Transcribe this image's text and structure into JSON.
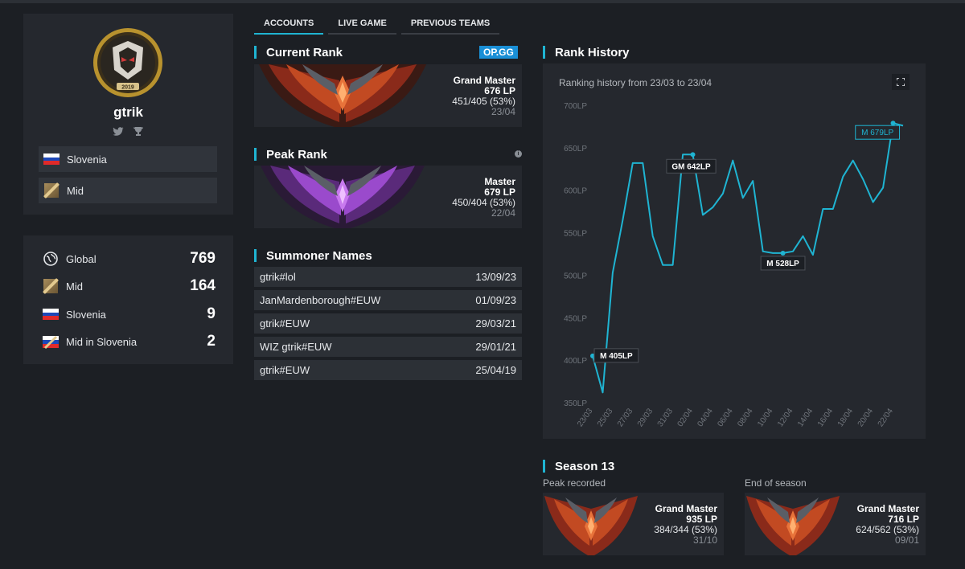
{
  "player": {
    "name": "gtrik",
    "logo_text": "2019"
  },
  "profile": {
    "country": "Slovenia",
    "role": "Mid"
  },
  "rankings": [
    {
      "label": "Global",
      "value": "769",
      "icon": "globe-icon"
    },
    {
      "label": "Mid",
      "value": "164",
      "icon": "mid-lane-icon"
    },
    {
      "label": "Slovenia",
      "value": "9",
      "icon": "slovenia-flag-icon"
    },
    {
      "label": "Mid in Slovenia",
      "value": "2",
      "icon": "mid-slovenia-icon"
    }
  ],
  "tabs": [
    {
      "label": "ACCOUNTS",
      "active": true
    },
    {
      "label": "LIVE GAME",
      "active": false
    },
    {
      "label": "PREVIOUS TEAMS",
      "active": false
    }
  ],
  "current_rank": {
    "title": "Current Rank",
    "source": "OP.GG",
    "tier": "Grand Master",
    "lp": "676 LP",
    "record": "451/405 (53%)",
    "date": "23/04"
  },
  "peak_rank": {
    "title": "Peak Rank",
    "tier": "Master",
    "lp": "679 LP",
    "record": "450/404 (53%)",
    "date": "22/04"
  },
  "summoner_names": {
    "title": "Summoner Names",
    "rows": [
      {
        "name": "gtrik#lol",
        "date": "13/09/23"
      },
      {
        "name": "JanMardenborough#EUW",
        "date": "01/09/23"
      },
      {
        "name": "gtrik#EUW",
        "date": "29/03/21"
      },
      {
        "name": "WIZ gtrik#EUW",
        "date": "29/01/21"
      },
      {
        "name": "gtrik#EUW",
        "date": "25/04/19"
      }
    ]
  },
  "rank_history": {
    "title": "Rank History",
    "subtitle": "Ranking history from 23/03 to 23/04"
  },
  "chart_data": {
    "type": "line",
    "x": [
      "23/03",
      "24/03",
      "25/03",
      "26/03",
      "27/03",
      "28/03",
      "29/03",
      "30/03",
      "31/03",
      "01/04",
      "02/04",
      "03/04",
      "04/04",
      "05/04",
      "06/04",
      "07/04",
      "08/04",
      "09/04",
      "10/04",
      "11/04",
      "12/04",
      "13/04",
      "14/04",
      "15/04",
      "16/04",
      "17/04",
      "18/04",
      "19/04",
      "20/04",
      "21/04",
      "22/04",
      "23/04"
    ],
    "xticks": [
      "23/03",
      "25/03",
      "27/03",
      "29/03",
      "31/03",
      "02/04",
      "04/04",
      "06/04",
      "08/04",
      "10/04",
      "12/04",
      "14/04",
      "16/04",
      "18/04",
      "20/04",
      "22/04"
    ],
    "series": [
      {
        "values": [
          405,
          362,
          503,
          565,
          632,
          632,
          546,
          512,
          512,
          642,
          642,
          571,
          580,
          596,
          635,
          591,
          611,
          528,
          526,
          526,
          528,
          546,
          524,
          578,
          578,
          616,
          635,
          613,
          586,
          603,
          679,
          676
        ],
        "color": "#1fb4d2"
      }
    ],
    "yticks": [
      350,
      400,
      450,
      500,
      550,
      600,
      650,
      700
    ],
    "ytick_suffix": "LP",
    "ylim": [
      350,
      700
    ],
    "grid": false,
    "annotations": [
      {
        "index": 0,
        "label": "M 405LP",
        "style": "dark"
      },
      {
        "index": 10,
        "label": "GM 642LP",
        "style": "dark"
      },
      {
        "index": 19,
        "label": "M 528LP",
        "style": "dark"
      },
      {
        "index": 30,
        "label": "M 679LP",
        "style": "accent"
      }
    ]
  },
  "season": {
    "title": "Season 13",
    "peak_label": "Peak recorded",
    "end_label": "End of season",
    "peak": {
      "tier": "Grand Master",
      "lp": "935 LP",
      "record": "384/344 (53%)",
      "date": "31/10"
    },
    "end": {
      "tier": "Grand Master",
      "lp": "716 LP",
      "record": "624/562 (53%)",
      "date": "09/01"
    }
  },
  "colors": {
    "accent": "#1fb4d2",
    "background": "#1c1f24",
    "panel": "#25282e",
    "opgg": "#1a8fd6"
  }
}
